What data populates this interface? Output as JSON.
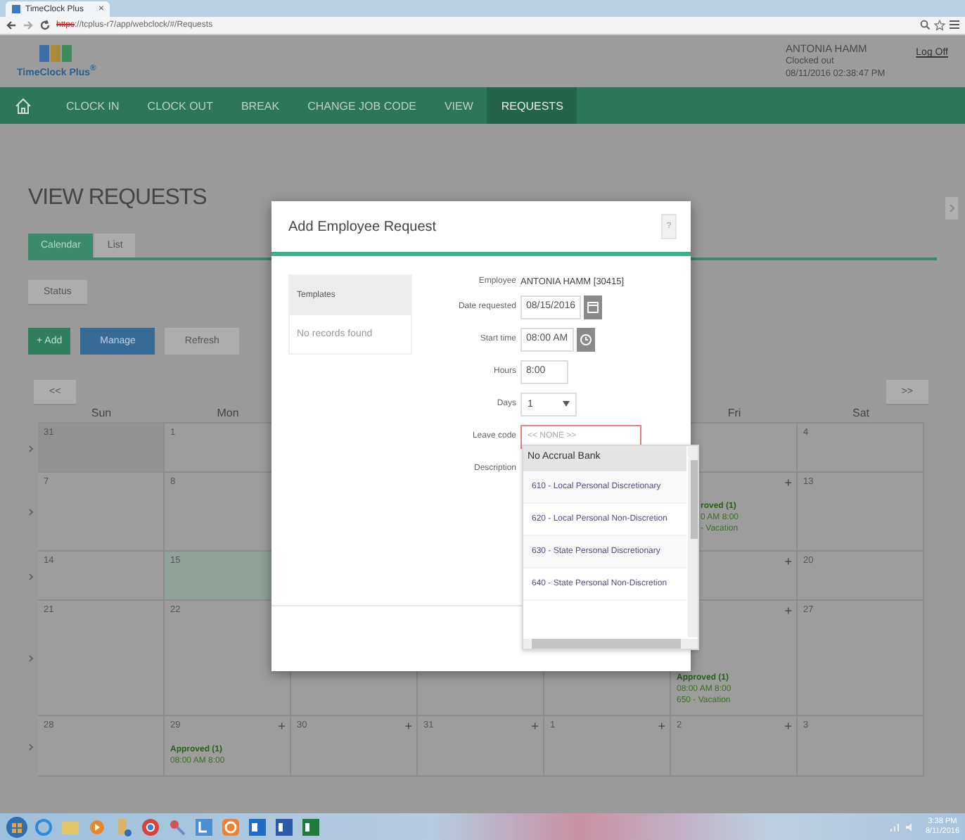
{
  "browser": {
    "tabs": [
      {
        "title": "TimeClock Plus",
        "close": "×",
        "selected": true
      }
    ],
    "url_scheme": "https",
    "url_rest": "://tcplus-r7/app/webclock/#/Requests"
  },
  "app": {
    "logo_text": "TimeClock Plus$^{®}$",
    "user": {
      "name": "ANTONIA HAMM",
      "status": "Clocked out",
      "timestamp": "08/11/2016 02:38:47 PM"
    },
    "log_off": "Log Off"
  },
  "nav": [
    {
      "label": "CLOCK IN",
      "selected": false
    },
    {
      "label": "CLOCK OUT",
      "selected": false
    },
    {
      "label": "BREAK",
      "selected": false
    },
    {
      "label": "CHANGE JOB CODE",
      "selected": false
    },
    {
      "label": "VIEW",
      "selected": false
    },
    {
      "label": "REQUESTS",
      "selected": true
    }
  ],
  "page": {
    "title": "VIEW REQUESTS",
    "view_tabs": [
      {
        "label": "Calendar",
        "selected": true
      },
      {
        "label": "List",
        "selected": false
      }
    ],
    "status_button": "Status",
    "actions": [
      {
        "label": "+ Add",
        "kind": "add"
      },
      {
        "label": "Manage",
        "kind": "manage"
      },
      {
        "label": "Refresh",
        "kind": "plain"
      }
    ],
    "prev": "<<",
    "next": ">>"
  },
  "calendar": {
    "day_headers": {
      "left": [
        "Sun",
        "Mon"
      ],
      "right": [
        "Fri",
        "Sat"
      ]
    },
    "weeks": [
      {
        "cells": [
          {
            "date": "31",
            "other_month": true
          },
          {
            "date": "1"
          },
          {},
          {},
          {},
          {},
          {
            "date": "4"
          }
        ]
      },
      {
        "cells": [
          {
            "date": "7"
          },
          {
            "date": "8"
          },
          {},
          {},
          {},
          {
            "add": "+",
            "events": [
              {
                "kind": "clipped",
                "status": "roved (1)",
                "time": "0 AM 8:00",
                "code": "- Vacation"
              }
            ]
          },
          {
            "date": "13"
          }
        ]
      },
      {
        "cells": [
          {
            "date": "14"
          },
          {
            "date": "15",
            "today": true
          },
          {},
          {},
          {},
          {
            "add": "+"
          },
          {
            "date": "20"
          }
        ]
      },
      {
        "cells": [
          {
            "date": "21"
          },
          {
            "date": "22"
          },
          {},
          {},
          {},
          {
            "add": "+",
            "events": [
              {
                "kind": "full",
                "status": "Approved (1)",
                "time": "08:00 AM 8:00",
                "code": "650 - Vacation"
              }
            ]
          },
          {
            "date": "27"
          }
        ]
      },
      {
        "cells": [
          {
            "date": "28"
          },
          {
            "date": "29",
            "add": "+",
            "events": [
              {
                "kind": "full",
                "status": "Approved (1)",
                "time": "08:00 AM 8:00"
              }
            ]
          },
          {
            "date": "30",
            "add": "+"
          },
          {
            "date": "31",
            "add": "+"
          },
          {
            "date": "1",
            "add": "+"
          },
          {
            "date": "2",
            "add": "+"
          },
          {
            "date": "3"
          }
        ]
      }
    ]
  },
  "modal": {
    "title": "Add Employee Request",
    "help": "?",
    "templates": {
      "header": "Templates",
      "empty": "No records found"
    },
    "fields": [
      {
        "label": "Employee",
        "kind": "text",
        "value": "ANTONIA HAMM [30415]"
      },
      {
        "label": "Date requested",
        "kind": "date",
        "value": "08/15/2016",
        "invalid": false
      },
      {
        "label": "Start time",
        "kind": "time",
        "value": "08:00 AM",
        "invalid": false
      },
      {
        "label": "Hours",
        "kind": "input",
        "value": "8:00",
        "invalid": false
      },
      {
        "label": "Days",
        "kind": "select",
        "value": "1",
        "invalid": false
      },
      {
        "label": "Leave code",
        "kind": "select",
        "placeholder": "<< NONE >>",
        "invalid": true
      },
      {
        "label": "Description",
        "kind": "textarea"
      }
    ],
    "dropdown": {
      "group": "No Accrual Bank",
      "options": [
        {
          "label": "610 - Local Personal Discretionary",
          "selected": false
        },
        {
          "label": "620 - Local Personal Non-Discretion",
          "selected": false
        },
        {
          "label": "630 - State Personal Discretionary",
          "selected": false
        },
        {
          "label": "640 - State Personal Non-Discretion",
          "selected": false
        }
      ]
    }
  },
  "taskbar": {
    "time": "3:38 PM",
    "date": "8/11/2016"
  }
}
